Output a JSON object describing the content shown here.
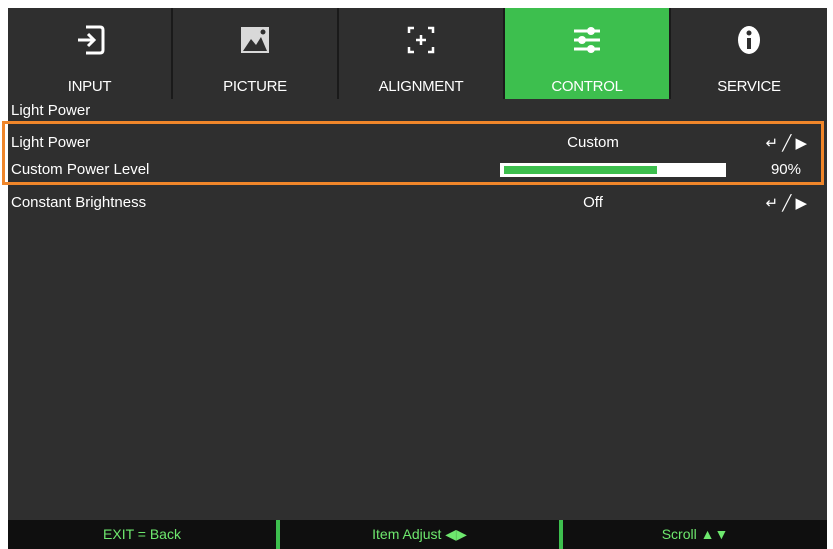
{
  "tabs": [
    {
      "label": "INPUT",
      "icon": "input-icon"
    },
    {
      "label": "PICTURE",
      "icon": "picture-icon"
    },
    {
      "label": "ALIGNMENT",
      "icon": "alignment-icon"
    },
    {
      "label": "CONTROL",
      "icon": "control-icon",
      "active": true
    },
    {
      "label": "SERVICE",
      "icon": "service-icon"
    }
  ],
  "section_title": "Light Power",
  "rows": [
    {
      "label": "Light Power",
      "value": "Custom",
      "action": "↵ ╱ ▶"
    },
    {
      "label": "Custom Power Level",
      "percent": "90%",
      "level": 0.9
    },
    {
      "label": "Constant Brightness",
      "value": "Off",
      "action": "↵ ╱ ▶"
    }
  ],
  "footer": {
    "exit": "EXIT = Back",
    "adjust": "Item Adjust ◀▶",
    "scroll": "Scroll ▲▼"
  },
  "colors": {
    "accent": "#3dbf4e",
    "highlight": "#f0862a",
    "background": "#2f2f2f"
  }
}
